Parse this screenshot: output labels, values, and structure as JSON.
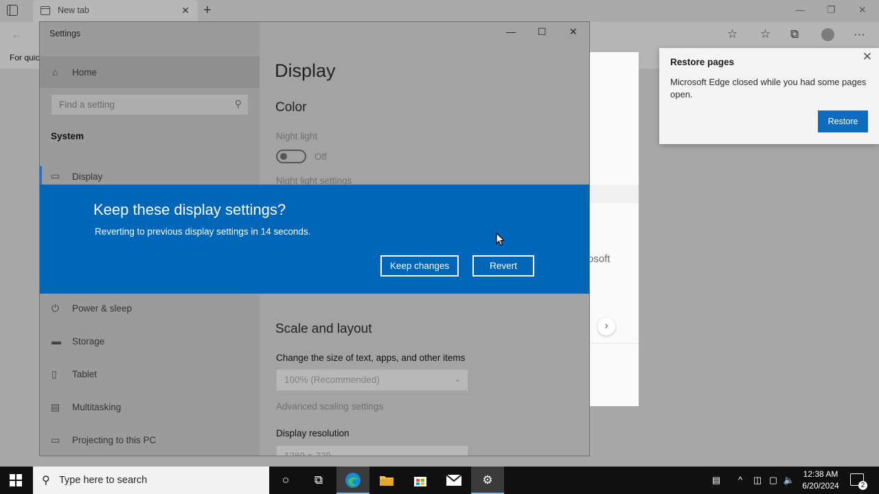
{
  "edge": {
    "tab_title": "New tab",
    "favorites_bar_text": "For quic",
    "card_partial_text": "osoft",
    "restore": {
      "title": "Restore pages",
      "message": "Microsoft Edge closed while you had some pages open.",
      "button": "Restore"
    }
  },
  "settings": {
    "window_title": "Settings",
    "sidebar": {
      "home": "Home",
      "search_placeholder": "Find a setting",
      "section": "System",
      "items": [
        {
          "label": "Display",
          "icon": "monitor-icon"
        },
        {
          "label": "Power & sleep",
          "icon": "power-icon"
        },
        {
          "label": "Storage",
          "icon": "storage-icon"
        },
        {
          "label": "Tablet",
          "icon": "tablet-icon"
        },
        {
          "label": "Multitasking",
          "icon": "multitasking-icon"
        },
        {
          "label": "Projecting to this PC",
          "icon": "projecting-icon"
        }
      ]
    },
    "main": {
      "page_title": "Display",
      "color_heading": "Color",
      "night_light_label": "Night light",
      "night_light_state": "Off",
      "night_light_settings": "Night light settings",
      "scale_heading": "Scale and layout",
      "scale_label": "Change the size of text, apps, and other items",
      "scale_value": "100% (Recommended)",
      "advanced_scaling": "Advanced scaling settings",
      "resolution_label": "Display resolution",
      "resolution_value": "1280 × 720"
    }
  },
  "dialog": {
    "heading": "Keep these display settings?",
    "message": "Reverting to previous display settings in 14 seconds.",
    "keep_button": "Keep changes",
    "revert_button": "Revert"
  },
  "taskbar": {
    "search_placeholder": "Type here to search",
    "time": "12:38 AM",
    "date": "6/20/2024",
    "notification_count": "2"
  },
  "colors": {
    "dialog_blue": "#0067b8",
    "restore_button": "#0f6cbd",
    "active_indicator": "#2d6ec4"
  }
}
